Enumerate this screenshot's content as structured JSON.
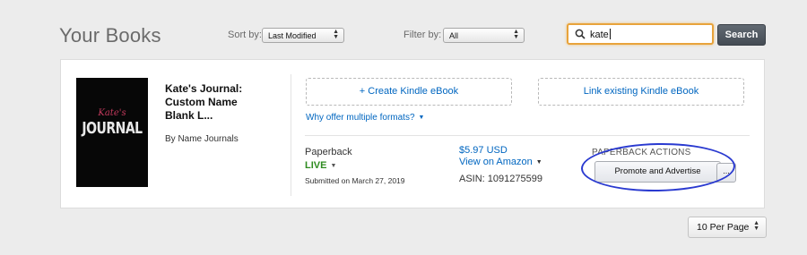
{
  "header": {
    "title": "Your Books",
    "sort": {
      "label": "Sort by:",
      "value": "Last Modified"
    },
    "filter": {
      "label": "Filter by:",
      "value": "All"
    },
    "search": {
      "value": "kate",
      "button_label": "Search"
    }
  },
  "book": {
    "cover": {
      "line1": "Kate's",
      "line2": "JOURNAL"
    },
    "title": "Kate's Journal: Custom Name Blank L...",
    "author": "By Name Journals",
    "create_kindle_label": "+ Create Kindle eBook",
    "link_kindle_label": "Link existing Kindle eBook",
    "why_formats_label": "Why offer multiple formats?",
    "format": "Paperback",
    "status": "LIVE",
    "submitted": "Submitted on March 27, 2019",
    "price": "$5.97 USD",
    "view_on_amazon": "View on Amazon",
    "asin": "ASIN: 1091275599",
    "actions_heading": "PAPERBACK ACTIONS",
    "promote_label": "Promote and Advertise",
    "more_label": "..."
  },
  "pagination": {
    "per_page": "10 Per Page"
  },
  "colors": {
    "link": "#0066c0",
    "live": "#2e8b1f",
    "search_focus": "#e8a33b",
    "annotation_circle": "#2a3ad0"
  }
}
